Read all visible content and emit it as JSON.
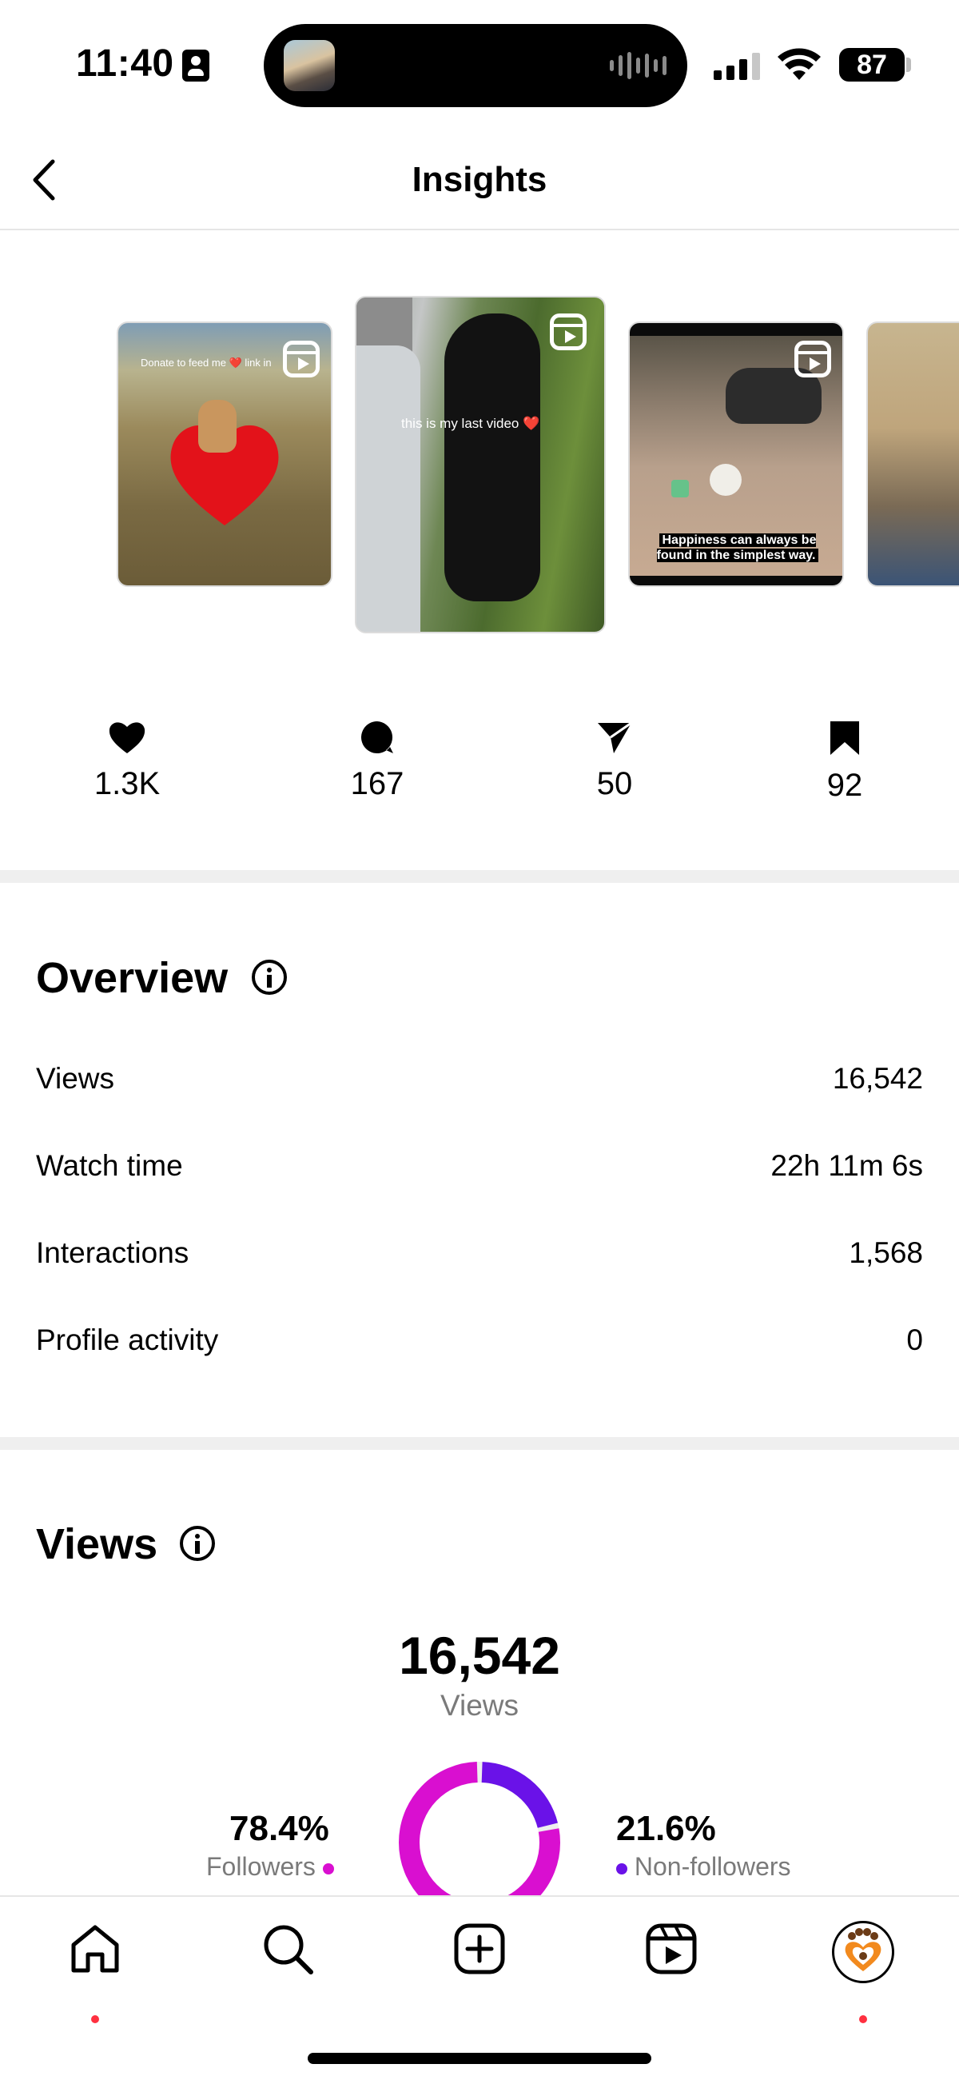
{
  "status_bar": {
    "time": "11:40",
    "battery": "87"
  },
  "header": {
    "title": "Insights"
  },
  "thumbnails": [
    {
      "caption": "Donate to feed me ❤️ link in"
    },
    {
      "caption": "this is my last video ❤️"
    },
    {
      "caption": "Happiness can always be found in the simplest way."
    },
    {
      "caption": ""
    }
  ],
  "metrics": {
    "likes": "1.3K",
    "comments": "167",
    "shares": "50",
    "saves": "92"
  },
  "overview": {
    "title": "Overview",
    "rows": [
      {
        "label": "Views",
        "value": "16,542"
      },
      {
        "label": "Watch time",
        "value": "22h 11m 6s"
      },
      {
        "label": "Interactions",
        "value": "1,568"
      },
      {
        "label": "Profile activity",
        "value": "0"
      }
    ]
  },
  "views": {
    "title": "Views",
    "total": "16,542",
    "total_label": "Views",
    "followers_pct": "78.4%",
    "followers_label": "Followers",
    "non_followers_pct": "21.6%",
    "non_followers_label": "Non-followers",
    "followers_fraction": 0.784,
    "colors": {
      "followers": "#d90fd0",
      "non_followers": "#6a12e8"
    }
  },
  "nav": {
    "items": [
      "home-icon",
      "search-icon",
      "create-icon",
      "reels-icon",
      "profile-avatar"
    ]
  }
}
